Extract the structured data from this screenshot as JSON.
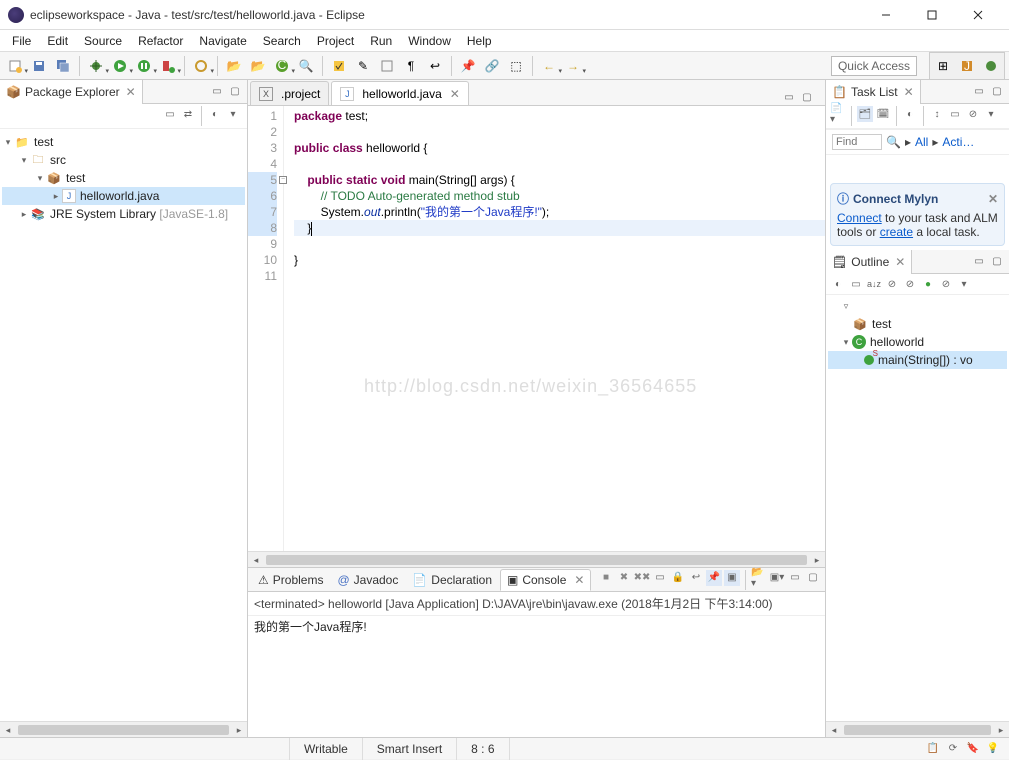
{
  "window": {
    "title": "eclipseworkspace - Java - test/src/test/helloworld.java - Eclipse"
  },
  "menu": [
    "File",
    "Edit",
    "Source",
    "Refactor",
    "Navigate",
    "Search",
    "Project",
    "Run",
    "Window",
    "Help"
  ],
  "quick_access": "Quick Access",
  "left": {
    "view_title": "Package Explorer",
    "tree": {
      "project": "test",
      "src": "src",
      "pkg": "test",
      "file": "helloworld.java",
      "jre": "JRE System Library",
      "jre_suffix": "[JavaSE-1.8]"
    }
  },
  "editor": {
    "tabs": [
      {
        "label": ".project",
        "icon": "X",
        "active": false
      },
      {
        "label": "helloworld.java",
        "icon": "J",
        "active": true
      }
    ],
    "code": {
      "l1_a": "package",
      "l1_b": " test;",
      "l3_a": "public",
      "l3_b": " ",
      "l3_c": "class",
      "l3_d": " helloworld {",
      "l5_a": "    ",
      "l5_b": "public",
      "l5_c": " ",
      "l5_d": "static",
      "l5_e": " ",
      "l5_f": "void",
      "l5_g": " main(String[] args) {",
      "l6_a": "        ",
      "l6_b": "// TODO Auto-generated method stub",
      "l7_a": "        System.",
      "l7_b": "out",
      "l7_c": ".println(",
      "l7_d": "\"我的第一个Java程序!\"",
      "l7_e": ");",
      "l8": "    }",
      "l10": "}"
    },
    "watermark": "http://blog.csdn.net/weixin_36564655"
  },
  "bottom": {
    "tabs": {
      "problems": "Problems",
      "javadoc": "Javadoc",
      "declaration": "Declaration",
      "console": "Console"
    },
    "console_head": "<terminated> helloworld [Java Application] D:\\JAVA\\jre\\bin\\javaw.exe (2018年1月2日 下午3:14:00)",
    "console_out": "我的第一个Java程序!"
  },
  "right": {
    "task_title": "Task List",
    "find_placeholder": "Find",
    "all": "All",
    "activate": "Acti…",
    "mylyn": {
      "title": "Connect Mylyn",
      "connect": "Connect",
      "mid": " to your task and ALM tools or ",
      "create": "create",
      "tail": " a local task."
    },
    "outline_title": "Outline",
    "outline": {
      "pkg": "test",
      "cls": "helloworld",
      "method": "main(String[]) : vo"
    }
  },
  "status": {
    "writable": "Writable",
    "insert": "Smart Insert",
    "pos": "8 : 6"
  }
}
